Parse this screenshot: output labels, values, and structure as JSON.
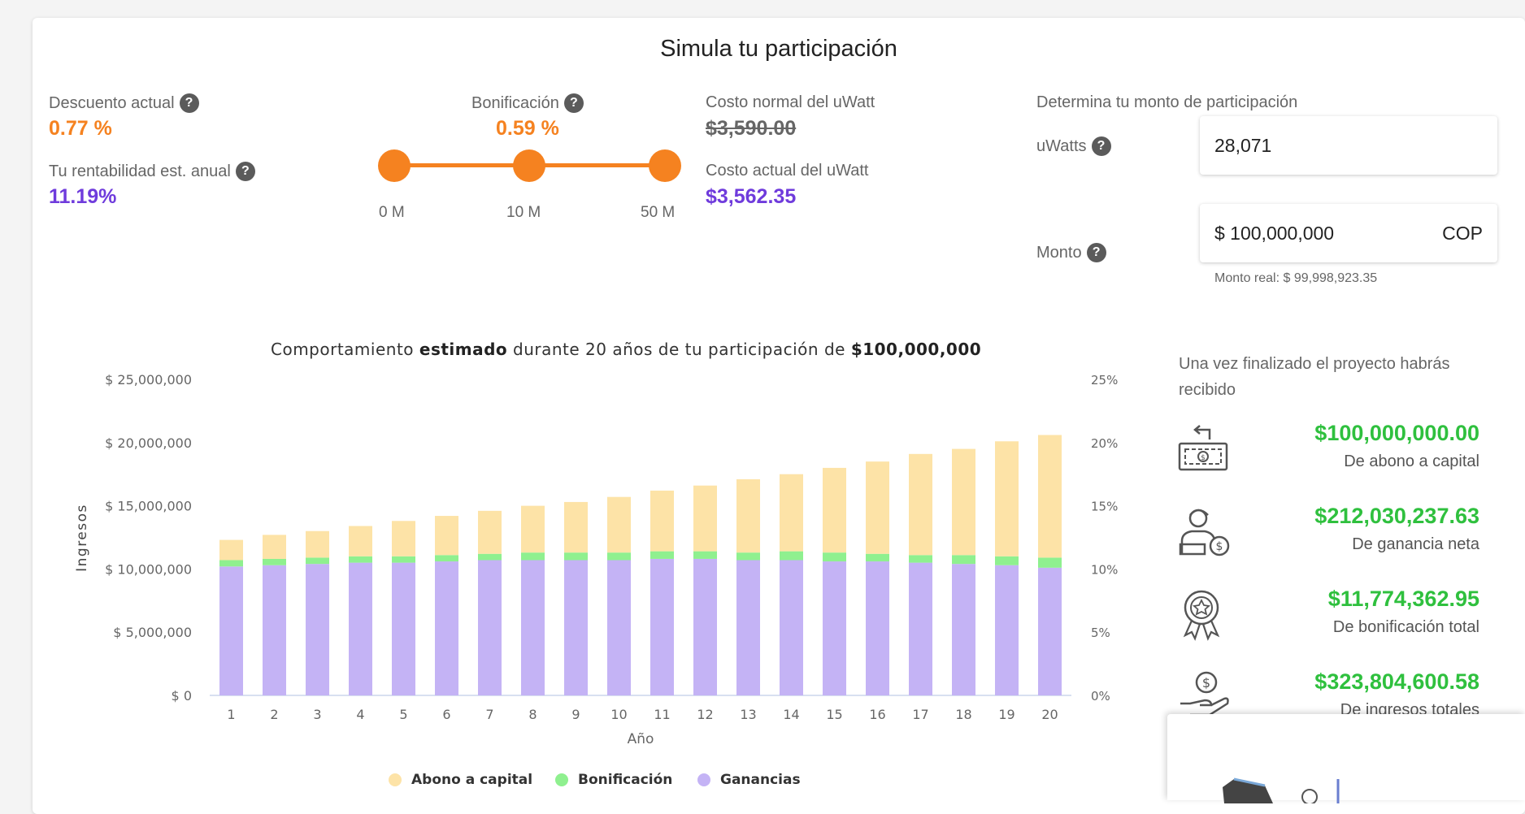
{
  "page": {
    "title": "Simula tu participación"
  },
  "descuento": {
    "label": "Descuento actual",
    "value": "0.77 %"
  },
  "rentabilidad": {
    "label": "Tu rentabilidad est. anual",
    "value": "11.19%"
  },
  "bonificacion": {
    "label": "Bonificación",
    "value": "0.59 %"
  },
  "slider": {
    "ticks": [
      "0 M",
      "10 M",
      "50 M"
    ],
    "color": "#f58220"
  },
  "costo_normal": {
    "label": "Costo normal del uWatt",
    "value": "$3,590.00"
  },
  "costo_actual": {
    "label": "Costo actual del uWatt",
    "value": "$3,562.35"
  },
  "participacion": {
    "heading": "Determina tu monto de participación",
    "uwatts_label": "uWatts",
    "uwatts_value": "28,071",
    "monto_label": "Monto",
    "monto_value": "$ 100,000,000",
    "currency": "COP",
    "monto_real": "Monto real: $ 99,998,923.35"
  },
  "chart_title": {
    "prefix": "Comportamiento ",
    "bold1": "estimado",
    "middle": " durante 20 años de tu participación de ",
    "bold2": "$100,000,000"
  },
  "chart_data": {
    "type": "bar",
    "stacked": true,
    "xlabel": "Año",
    "ylabel": "Ingresos",
    "ylim": [
      0,
      25000000
    ],
    "y2lim": [
      0,
      25
    ],
    "y_ticks": [
      "$ 0",
      "$ 5,000,000",
      "$ 10,000,000",
      "$ 15,000,000",
      "$ 20,000,000",
      "$ 25,000,000"
    ],
    "y2_ticks": [
      "0%",
      "5%",
      "10%",
      "15%",
      "20%",
      "25%"
    ],
    "categories": [
      "1",
      "2",
      "3",
      "4",
      "5",
      "6",
      "7",
      "8",
      "9",
      "10",
      "11",
      "12",
      "13",
      "14",
      "15",
      "16",
      "17",
      "18",
      "19",
      "20"
    ],
    "grid": false,
    "legend": "bottom",
    "series": [
      {
        "name": "Ganancias",
        "color": "#c4b3f5",
        "values": [
          10200000,
          10300000,
          10400000,
          10500000,
          10500000,
          10600000,
          10700000,
          10700000,
          10700000,
          10700000,
          10800000,
          10800000,
          10700000,
          10700000,
          10600000,
          10600000,
          10500000,
          10400000,
          10300000,
          10100000
        ]
      },
      {
        "name": "Bonificación",
        "color": "#8ff08f",
        "values": [
          500000,
          500000,
          500000,
          500000,
          500000,
          500000,
          500000,
          600000,
          600000,
          600000,
          600000,
          600000,
          600000,
          700000,
          700000,
          600000,
          600000,
          700000,
          700000,
          800000
        ]
      },
      {
        "name": "Abono a capital",
        "color": "#fde3a7",
        "values": [
          1600000,
          1900000,
          2100000,
          2400000,
          2800000,
          3100000,
          3400000,
          3700000,
          4000000,
          4400000,
          4800000,
          5200000,
          5800000,
          6100000,
          6700000,
          7300000,
          8000000,
          8400000,
          9100000,
          9700000
        ]
      }
    ]
  },
  "summary": {
    "intro": "Una vez finalizado el proyecto habrás recibido",
    "items": [
      {
        "icon": "cash-return-icon",
        "amount": "$100,000,000.00",
        "desc": "De abono a capital"
      },
      {
        "icon": "person-money-icon",
        "amount": "$212,030,237.63",
        "desc": "De ganancia neta"
      },
      {
        "icon": "award-medal-icon",
        "amount": "$11,774,362.95",
        "desc": "De bonificación total"
      },
      {
        "icon": "hand-coin-icon",
        "amount": "$323,804,600.58",
        "desc": "De ingresos totales"
      }
    ]
  }
}
